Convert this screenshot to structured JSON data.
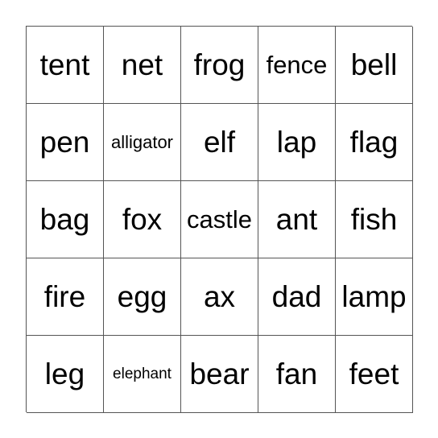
{
  "board": {
    "rows": [
      [
        "tent",
        "net",
        "frog",
        "fence",
        "bell"
      ],
      [
        "pen",
        "alligator",
        "elf",
        "lap",
        "flag"
      ],
      [
        "bag",
        "fox",
        "castle",
        "ant",
        "fish"
      ],
      [
        "fire",
        "egg",
        "ax",
        "dad",
        "lamp"
      ],
      [
        "leg",
        "elephant",
        "bear",
        "fan",
        "feet"
      ]
    ]
  }
}
